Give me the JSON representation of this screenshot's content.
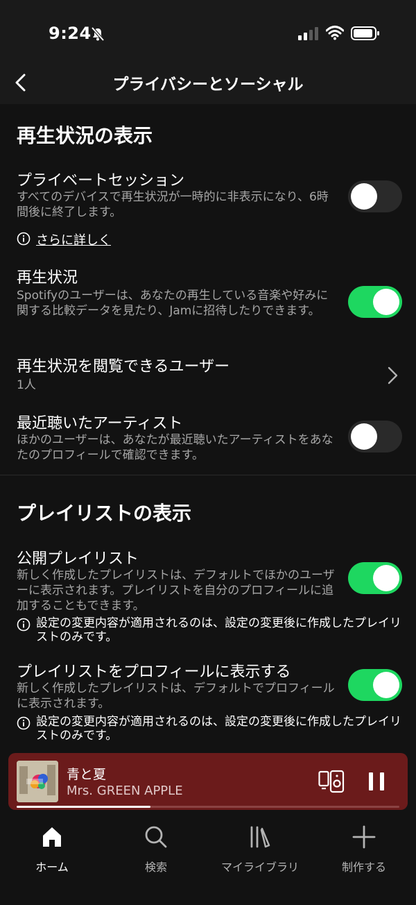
{
  "status_bar": {
    "time": "9:24",
    "icons": [
      "bell-slash-icon",
      "signal-icon",
      "wifi-icon",
      "battery-icon"
    ]
  },
  "header": {
    "title": "プライバシーとソーシャル",
    "back_icon": "chevron-left-icon"
  },
  "sections": {
    "listening": {
      "title": "再生状況の表示",
      "private_session": {
        "title": "プライベートセッション",
        "desc": "すべてのデバイスで再生状況が一時的に非表示になり、6時間後に終了します。",
        "learn_more": "さらに詳しく",
        "enabled": false
      },
      "activity": {
        "title": "再生状況",
        "desc": "Spotifyのユーザーは、あなたの再生している音楽や好みに関する比較データを見たり、Jamに招待したりできます。",
        "enabled": true
      },
      "viewers": {
        "title": "再生状況を閲覧できるユーザー",
        "value": "1人"
      },
      "recent_artists": {
        "title": "最近聴いたアーティスト",
        "desc": "ほかのユーザーは、あなたが最近聴いたアーティストをあなたのプロフィールで確認できます。",
        "enabled": false
      }
    },
    "playlists": {
      "title": "プレイリストの表示",
      "public_playlists": {
        "title": "公開プレイリスト",
        "desc": "新しく作成したプレイリストは、デフォルトでほかのユーザーに表示されます。プレイリストを自分のプロフィールに追加することもできます。",
        "info": "設定の変更内容が適用されるのは、設定の変更後に作成したプレイリストのみです。",
        "enabled": true
      },
      "show_on_profile": {
        "title": "プレイリストをプロフィールに表示する",
        "desc": "新しく作成したプレイリストは、デフォルトでプロフィールに表示されます。",
        "info": "設定の変更内容が適用されるのは、設定の変更後に作成したプレイリストのみです。",
        "enabled": true
      }
    }
  },
  "player": {
    "track": "青と夏",
    "artist": "Mrs. GREEN APPLE",
    "progress": 0.35,
    "bg_color": "#6b1b1b"
  },
  "bottom_nav": [
    {
      "label": "ホーム",
      "icon": "home-icon",
      "active": true
    },
    {
      "label": "検索",
      "icon": "search-icon",
      "active": false
    },
    {
      "label": "マイライブラリ",
      "icon": "library-icon",
      "active": false
    },
    {
      "label": "制作する",
      "icon": "plus-icon",
      "active": false
    }
  ],
  "colors": {
    "accent": "#1ed760",
    "background": "#121212"
  }
}
